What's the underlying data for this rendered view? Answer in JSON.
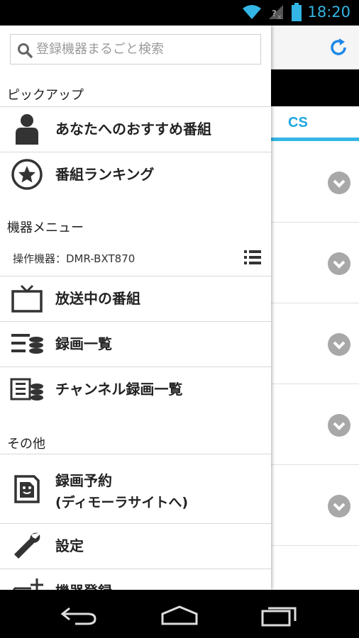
{
  "statusbar": {
    "time": "18:20",
    "icons": [
      "wifi-icon",
      "no-signal-icon",
      "battery-icon"
    ],
    "accent": "#33b5e5"
  },
  "background_app": {
    "tab_label": "CS",
    "tab_color": "#1ea6df",
    "rows": [
      {
        "icon": "chevron-down-icon"
      },
      {
        "icon": "chevron-down-icon"
      },
      {
        "icon": "chevron-down-icon"
      },
      {
        "icon": "chevron-down-icon"
      },
      {
        "icon": "chevron-down-icon"
      }
    ],
    "refresh_icon": "refresh-icon"
  },
  "drawer": {
    "search": {
      "placeholder": "登録機器まるごと検索"
    },
    "sections": {
      "pickup": "ピックアップ",
      "device_menu": "機器メニュー",
      "other": "その他"
    },
    "pickup_items": [
      {
        "label": "あなたへのおすすめ番組",
        "icon": "person-icon"
      },
      {
        "label": "番組ランキング",
        "icon": "star-circle-icon"
      }
    ],
    "device": {
      "label": "操作機器：DMR-BXT870",
      "icon": "list-icon"
    },
    "device_items": [
      {
        "label": "放送中の番組",
        "icon": "tv-icon"
      },
      {
        "label": "録画一覧",
        "icon": "recordings-icon"
      },
      {
        "label": "チャンネル録画一覧",
        "icon": "channel-recordings-icon"
      }
    ],
    "other_items": [
      {
        "label": "録画予約",
        "label2": "(ディモーラサイトへ)",
        "icon": "diga-icon"
      },
      {
        "label": "設定",
        "icon": "wrench-icon"
      },
      {
        "label": "機器登録",
        "icon": "add-device-icon"
      }
    ]
  },
  "navbar": {
    "buttons": [
      "back-icon",
      "home-icon",
      "recent-apps-icon"
    ]
  }
}
